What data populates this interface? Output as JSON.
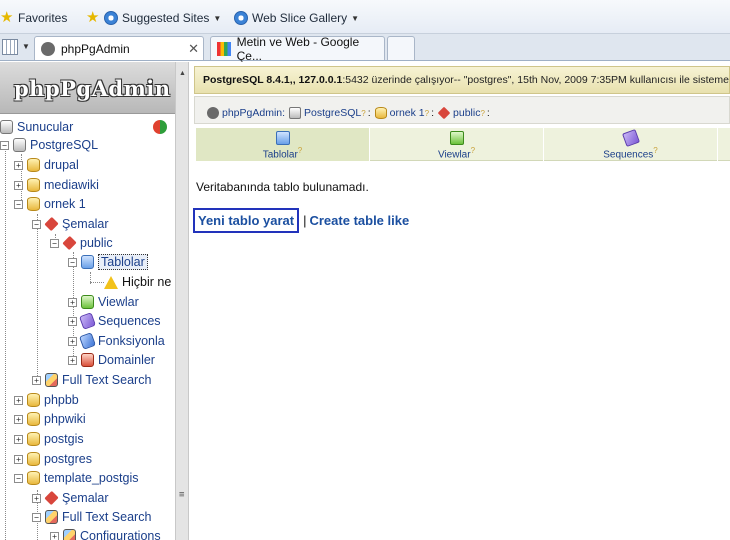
{
  "favbar": {
    "favorites": "Favorites",
    "suggested": "Suggested Sites",
    "webslice": "Web Slice Gallery"
  },
  "tabs": [
    {
      "title": "phpPgAdmin"
    },
    {
      "title": "Metin ve Web - Google Çe..."
    }
  ],
  "logo": "phpPgAdmin",
  "tree": {
    "servers": "Sunucular",
    "postgresql": "PostgreSQL",
    "drupal": "drupal",
    "mediawiki": "mediawiki",
    "ornek1": "ornek 1",
    "semalar": "Şemalar",
    "public": "public",
    "tablolar": "Tablolar",
    "hicbir": "Hiçbir ne",
    "viewlar": "Viewlar",
    "sequences": "Sequences",
    "fonksiyonlar": "Fonksiyonla",
    "domainler": "Domainler",
    "fulltext": "Full Text Search",
    "phpbb": "phpbb",
    "phpwiki": "phpwiki",
    "postgis": "postgis",
    "postgres": "postgres",
    "template_postgis": "template_postgis",
    "semalar2": "Şemalar",
    "fulltext2": "Full Text Search",
    "configurations": "Configurations"
  },
  "topbar": {
    "version": "PostgreSQL 8.4.1,",
    "host": ", 127.0.0.1",
    "rest": ":5432 üzerinde çalışıyor-- \"postgres\", 15th Nov, 2009 7:35PM kullanıcısı ile sisteme"
  },
  "breadcrumb": {
    "app": "phpPgAdmin:",
    "server": "PostgreSQL",
    "db": "ornek 1",
    "schema": "public"
  },
  "pagetabs": {
    "tables": "Tablolar",
    "views": "Viewlar",
    "sequences": "Sequences"
  },
  "message": "Veritabanında tablo bulunamadı.",
  "actions": {
    "create": "Yeni tablo yarat",
    "create_like": "Create table like"
  },
  "colors": {
    "link": "#1b4fa0",
    "focus_box": "#2233bb",
    "info_bar": "#efe8bc"
  }
}
